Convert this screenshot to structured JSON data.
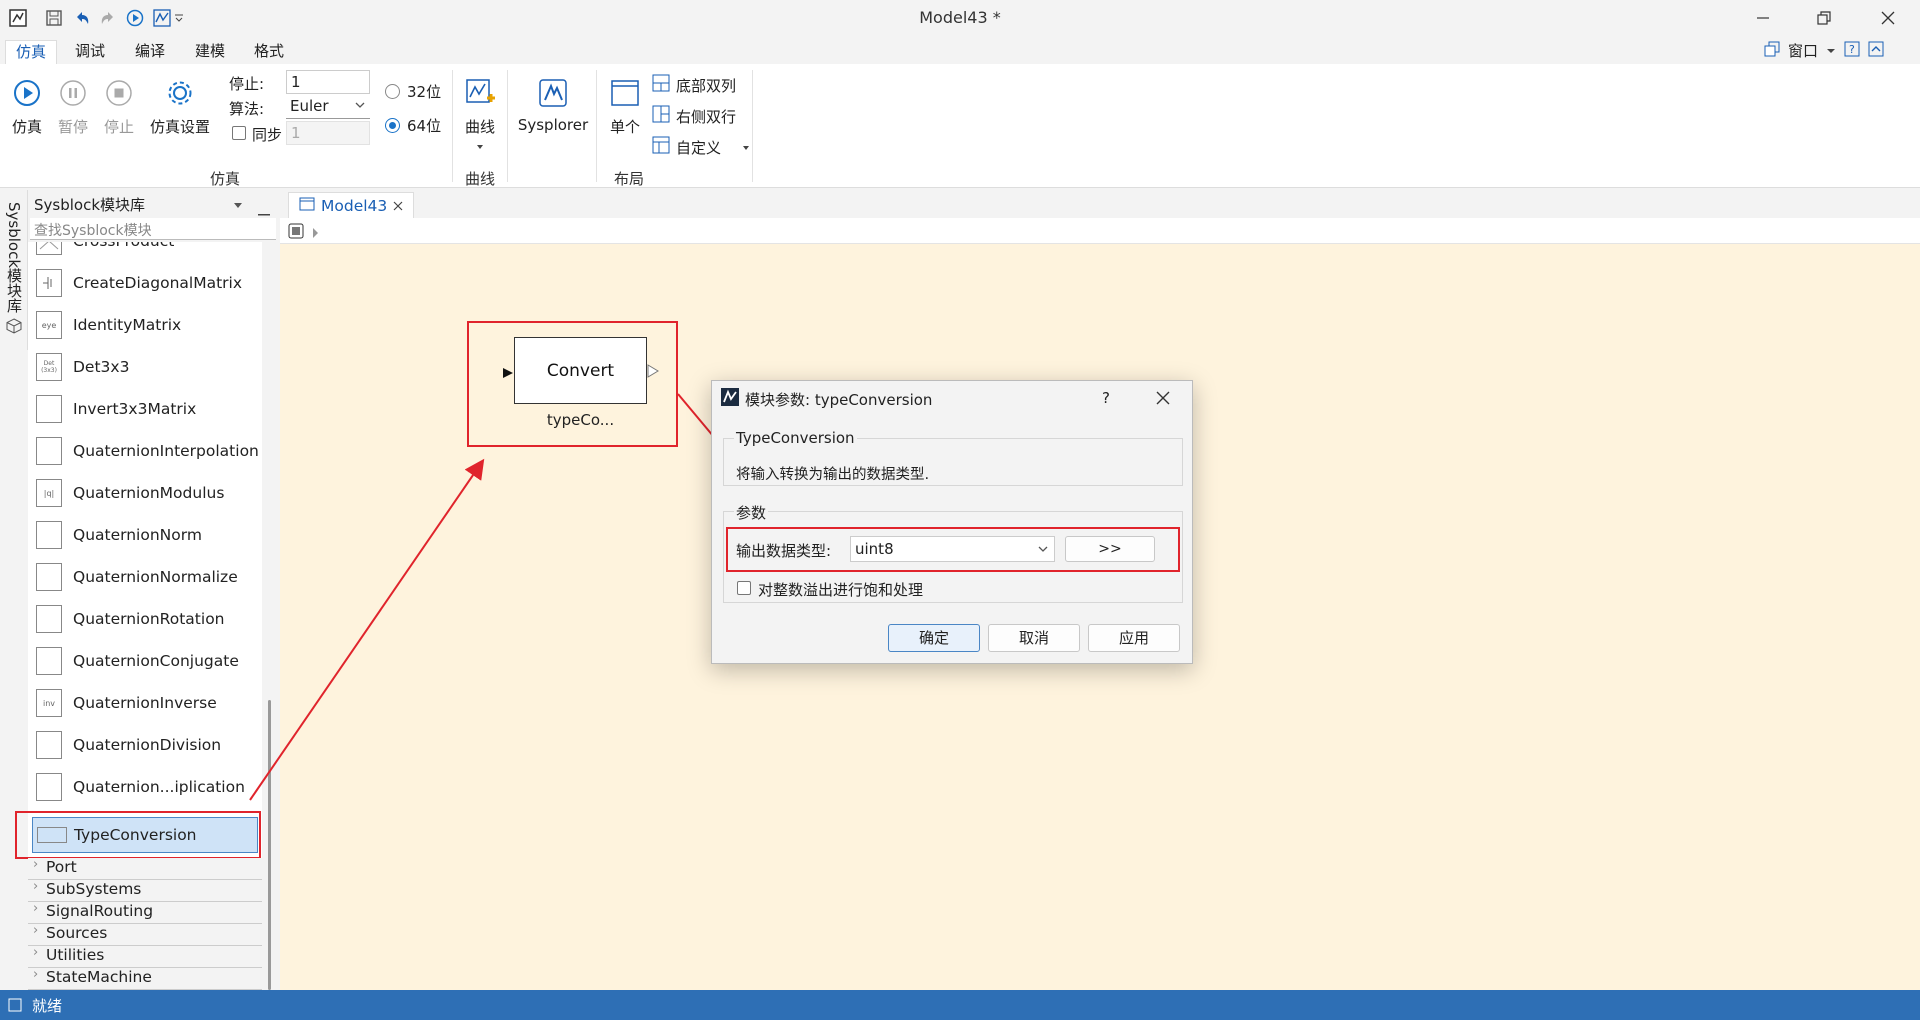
{
  "window": {
    "title": "Model43 *"
  },
  "menu": {
    "tabs": [
      "仿真",
      "调试",
      "编译",
      "建模",
      "格式"
    ],
    "window_menu_label": "窗口"
  },
  "ribbon": {
    "simulate": {
      "run_label": "仿真",
      "pause_label": "暂停",
      "stop_label": "停止",
      "settings_label": "仿真设置",
      "group_label": "仿真"
    },
    "params": {
      "stop_label": "停止:",
      "stop_value": "1",
      "algorithm_label": "算法:",
      "algorithm_value": "Euler",
      "sync_label": "同步",
      "sync_value": "1",
      "bit32_label": "32位",
      "bit64_label": "64位",
      "selected_bits": "64位"
    },
    "curve": {
      "label": "曲线",
      "group_label": "曲线"
    },
    "sysplorer": {
      "label": "Sysplorer"
    },
    "layout": {
      "single_label": "单个",
      "bottom_two_cols": "底部双列",
      "right_two_rows": "右侧双行",
      "custom": "自定义",
      "group_label": "布局"
    }
  },
  "sidebar": {
    "vertical_tab_label": "Sysblock模块库"
  },
  "library": {
    "title": "Sysblock模块库",
    "search_placeholder": "查找Sysblock模块",
    "items": [
      {
        "name": "CrossProduct",
        "thumb": ""
      },
      {
        "name": "CreateDiagonalMatrix",
        "thumb": ""
      },
      {
        "name": "IdentityMatrix",
        "thumb": "eye"
      },
      {
        "name": "Det3x3",
        "thumb": "Det (3x3)"
      },
      {
        "name": "Invert3x3Matrix",
        "thumb": ""
      },
      {
        "name": "QuaternionInterpolation",
        "thumb": ""
      },
      {
        "name": "QuaternionModulus",
        "thumb": "|q|"
      },
      {
        "name": "QuaternionNorm",
        "thumb": ""
      },
      {
        "name": "QuaternionNormalize",
        "thumb": ""
      },
      {
        "name": "QuaternionRotation",
        "thumb": ""
      },
      {
        "name": "QuaternionConjugate",
        "thumb": ""
      },
      {
        "name": "QuaternionInverse",
        "thumb": "inv"
      },
      {
        "name": "QuaternionDivision",
        "thumb": ""
      },
      {
        "name": "Quaternion...iplication",
        "thumb": ""
      },
      {
        "name": "TypeConversion",
        "thumb": ""
      }
    ],
    "selected": "TypeConversion",
    "categories": [
      "Port",
      "SubSystems",
      "SignalRouting",
      "Sources",
      "Utilities",
      "StateMachine"
    ]
  },
  "editor": {
    "tab_label": "Model43",
    "block": {
      "label": "Convert",
      "caption": "typeCo..."
    }
  },
  "dialog": {
    "title": "模块参数: typeConversion",
    "help_label": "?",
    "block_type": "TypeConversion",
    "description": "将输入转换为输出的数据类型.",
    "params_legend": "参数",
    "output_type_label": "输出数据类型:",
    "output_type_value": "uint8",
    "more_label": ">>",
    "saturate_label": "对整数溢出进行饱和处理",
    "ok_label": "确定",
    "cancel_label": "取消",
    "apply_label": "应用"
  },
  "status": {
    "text": "就绪"
  },
  "colors": {
    "accent": "#1a73c8",
    "highlight": "#e0242c",
    "canvas": "#fef3dd",
    "statusbar": "#2e6fb5"
  }
}
